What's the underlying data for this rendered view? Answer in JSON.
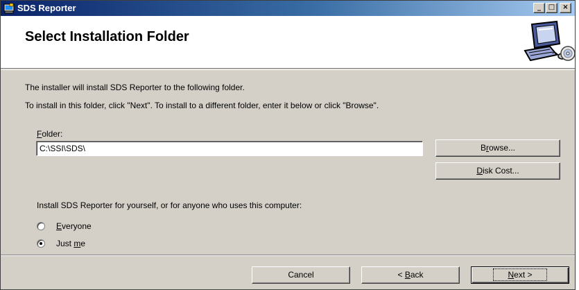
{
  "window": {
    "title": "SDS Reporter",
    "controls": {
      "minimize": "_",
      "maximize": "□",
      "close": "×"
    },
    "icon": "installer-icon"
  },
  "banner": {
    "title": "Select Installation Folder",
    "art_icon": "computer-cd-icon"
  },
  "body": {
    "line1": "The installer will install SDS Reporter to the following folder.",
    "line2": "To install in this folder, click \"Next\". To install to a different folder, enter it below or click \"Browse\".",
    "folder_label_mnemonic": "F",
    "folder_label_rest": "older:",
    "folder_value": "C:\\SSI\\SDS\\",
    "browse_pre": "B",
    "browse_mnemonic": "r",
    "browse_post": "owse...",
    "diskcost_mnemonic": "D",
    "diskcost_rest": "isk Cost...",
    "install_for": "Install SDS Reporter for yourself, or for anyone who uses this computer:",
    "radio_everyone_mnemonic": "E",
    "radio_everyone_rest": "veryone",
    "radio_justme_pre": "Just ",
    "radio_justme_mnemonic": "m",
    "radio_justme_post": "e",
    "selected_option": "Just me"
  },
  "footer": {
    "cancel": "Cancel",
    "back_pre": "< ",
    "back_mnemonic": "B",
    "back_post": "ack",
    "next_mnemonic": "N",
    "next_post": "ext >"
  }
}
